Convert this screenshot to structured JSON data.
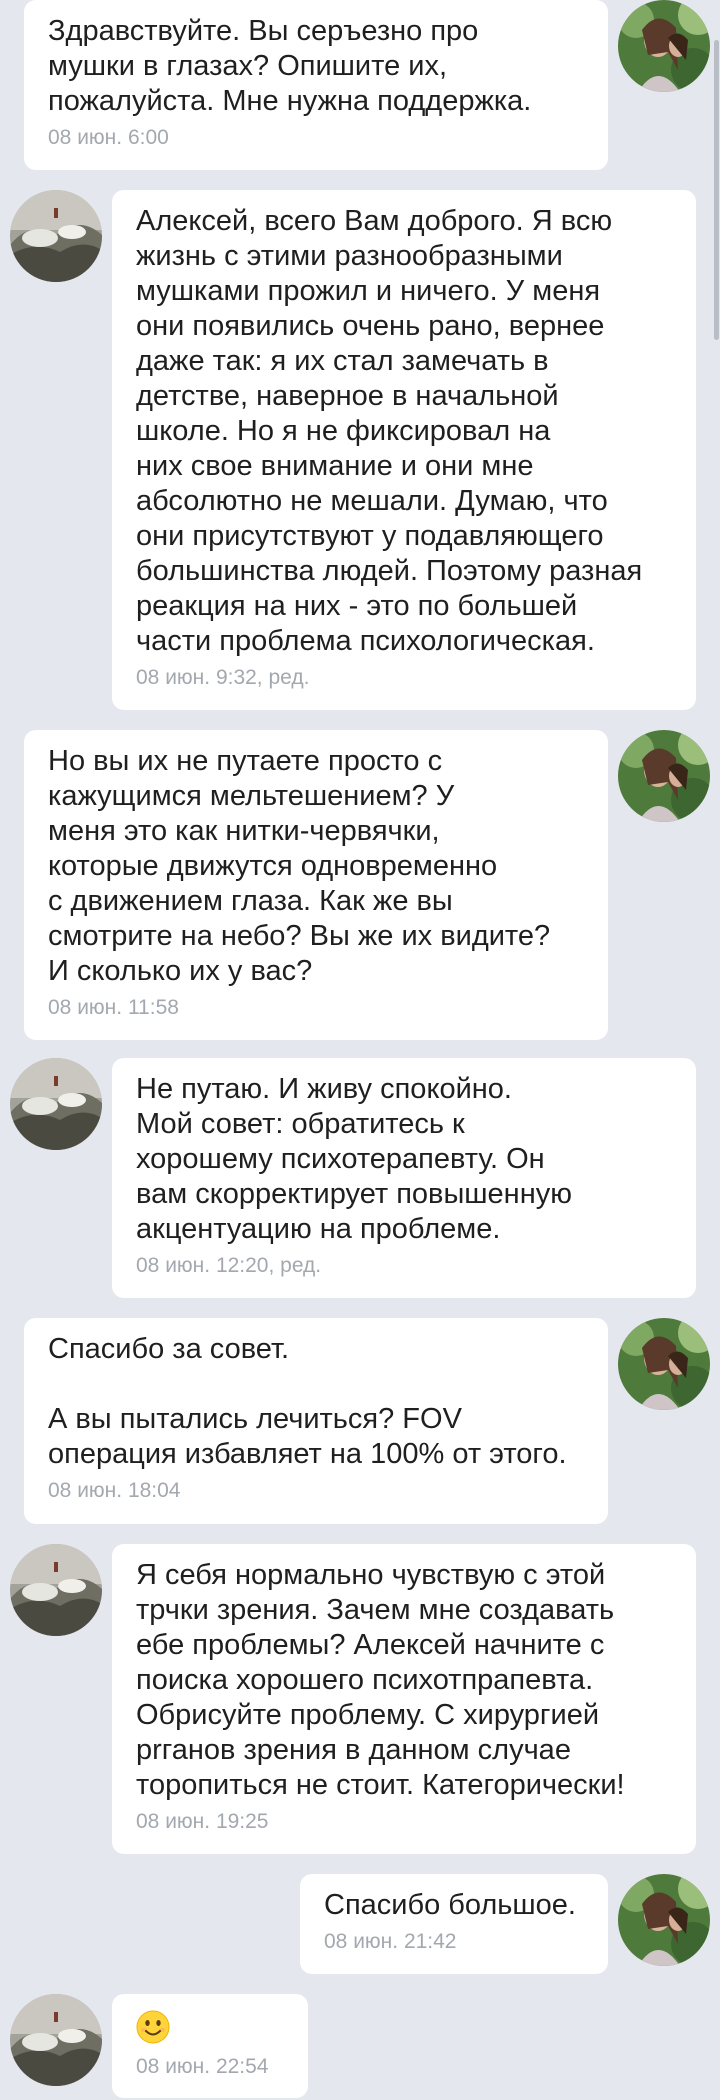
{
  "messages": [
    {
      "side": "right",
      "text": "Здравствуйте. Вы серъезно про\nмушки в глазах? Опишите их,\nпожалуйста. Мне нужна поддержка.",
      "time": "08 июн. 6:00"
    },
    {
      "side": "left",
      "text": "Алексей, всего Вам доброго. Я всю\nжизнь с этими разнообразными\nмушками прожил и ничего. У меня\nони появились очень рано, вернее\nдаже так: я их стал замечать в\nдетстве, наверное в начальной\nшколе. Но я не фиксировал на\nних свое внимание и они мне\nабсолютно не мешали. Думаю, что\nони присутствуют у подавляющего\nбольшинства людей. Поэтому разная\nреакция на них - это по большей\nчасти проблема психологическая.",
      "time": "08 июн. 9:32, ред."
    },
    {
      "side": "right",
      "text": "Но вы их не путаете просто с\nкажущимся мельтешением? У\nменя это как нитки-червячки,\nкоторые движутся одновременно\nс движением глаза. Как же вы\nсмотрите на небо? Вы же их видите?\nИ сколько их у вас?",
      "time": "08 июн. 11:58"
    },
    {
      "side": "left",
      "text": "Не путаю. И живу спокойно.\nМой совет: обратитесь к\nхорошему психотерапевту. Он\nвам скорректирует повышенную\nакцентуацию на проблеме.",
      "time": "08 июн. 12:20, ред."
    },
    {
      "side": "right",
      "text": "Спасибо за совет.\n\nА вы пытались лечиться? FOV\nоперация избавляет на 100% от этого.",
      "time": "08 июн. 18:04"
    },
    {
      "side": "left",
      "text": "Я себя нормально чувствую с этой\nтрчки зрения. Зачем мне создавать\nебе проблемы? Алексей начните с\nпоиска хорошего психотпрапевта.\nОбрисуйте проблему. С хирургией\nрrганов зрения в данном случае\nторопиться не стоит. Категорически!",
      "time": "08 июн. 19:25"
    },
    {
      "side": "right",
      "text": "Спасибо большое.",
      "time": "08 июн. 21:42"
    },
    {
      "side": "left",
      "emoji": "smiling-face-emoji",
      "time": "08 июн. 22:54"
    }
  ]
}
